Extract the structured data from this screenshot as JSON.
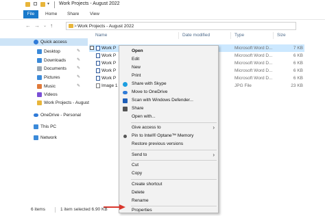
{
  "titlebar": {
    "title": "Work Projects - August 2022",
    "qa_dropdown": "▾"
  },
  "ribbon": {
    "tabs": [
      "File",
      "Home",
      "Share",
      "View"
    ]
  },
  "address": {
    "path": "Work Projects - August 2022",
    "separator": ">",
    "back": "←",
    "forward": "→",
    "up": "↑",
    "dropdown": "⌄"
  },
  "nav": {
    "items": [
      {
        "label": "Quick access",
        "icon": "star-icon",
        "color": "#2f7bd8"
      },
      {
        "label": "Desktop",
        "icon": "desktop-icon",
        "color": "#3b8ad9",
        "pinned": true
      },
      {
        "label": "Downloads",
        "icon": "download-icon",
        "color": "#3b8ad9",
        "pinned": true
      },
      {
        "label": "Documents",
        "icon": "document-icon",
        "color": "#9aa7b4",
        "pinned": true
      },
      {
        "label": "Pictures",
        "icon": "picture-icon",
        "color": "#3b8ad9",
        "pinned": true
      },
      {
        "label": "Music",
        "icon": "music-icon",
        "color": "#e07a3a",
        "pinned": true
      },
      {
        "label": "Videos",
        "icon": "video-icon",
        "color": "#7a4fd6"
      },
      {
        "label": "Work Projects - August",
        "icon": "folder-icon",
        "color": "#e8b53a"
      },
      {
        "label": "OneDrive - Personal",
        "icon": "cloud-icon",
        "color": "#2f7bd8"
      },
      {
        "label": "This PC",
        "icon": "computer-icon",
        "color": "#3b8ad9"
      },
      {
        "label": "Network",
        "icon": "network-icon",
        "color": "#3b8ad9"
      }
    ],
    "pin_glyph": "✎"
  },
  "columns": {
    "name": "Name",
    "date": "Date modified",
    "type": "Type",
    "size": "Size"
  },
  "files": [
    {
      "name": "Work P",
      "type": "Microsoft Word D...",
      "size": "7 KB",
      "selected": true
    },
    {
      "name": "Work P",
      "type": "Microsoft Word D...",
      "size": "6 KB"
    },
    {
      "name": "Work P",
      "type": "Microsoft Word D...",
      "size": "6 KB"
    },
    {
      "name": "Work P",
      "type": "Microsoft Word D...",
      "size": "6 KB"
    },
    {
      "name": "Work P",
      "type": "Microsoft Word D...",
      "size": "6 KB"
    },
    {
      "name": "Image 1",
      "type": "JPG File",
      "size": "23 KB"
    }
  ],
  "context_menu": {
    "items": [
      {
        "label": "Open",
        "bold": true
      },
      {
        "label": "Edit"
      },
      {
        "label": "New"
      },
      {
        "label": "Print"
      },
      {
        "label": "Share with Skype",
        "icon": "skype-icon",
        "icon_color": "#1c9ee0"
      },
      {
        "label": "Move to OneDrive",
        "icon": "onedrive-icon",
        "icon_color": "#2f7bd8"
      },
      {
        "label": "Scan with Windows Defender...",
        "icon": "defender-icon",
        "icon_color": "#1f5fb8"
      },
      {
        "label": "Share",
        "icon": "share-icon",
        "icon_color": "#555555"
      },
      {
        "label": "Open with..."
      },
      {
        "label": "Give access to",
        "submenu": true
      },
      {
        "label": "Pin to Intel® Optane™ Memory",
        "icon": "intel-pin-icon",
        "icon_color": "#555555"
      },
      {
        "label": "Restore previous versions"
      },
      {
        "label": "Send to",
        "submenu": true
      },
      {
        "label": "Cut"
      },
      {
        "label": "Copy"
      },
      {
        "label": "Create shortcut"
      },
      {
        "label": "Delete"
      },
      {
        "label": "Rename"
      },
      {
        "label": "Properties"
      }
    ],
    "submenu_glyph": "›"
  },
  "status": {
    "count": "6 items",
    "selection": "1 item selected 6.90 KB"
  },
  "colors": {
    "accent": "#1979ca",
    "selection": "#cce8ff",
    "arrow": "#d9352b"
  }
}
